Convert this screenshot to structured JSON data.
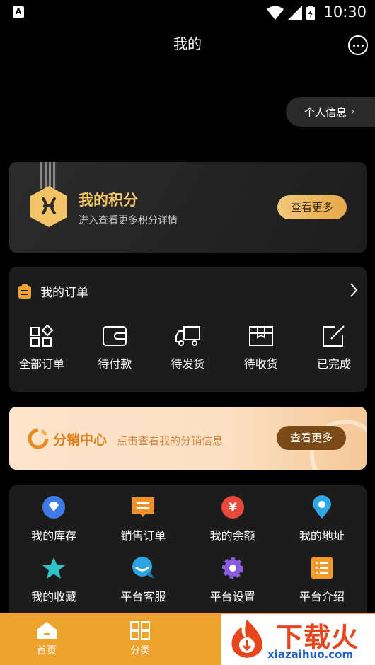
{
  "status_bar": {
    "app_badge": "A",
    "time": "10:30"
  },
  "header": {
    "title": "我的"
  },
  "profile_pill": {
    "label": "个人信息",
    "chevron": "›"
  },
  "points_card": {
    "title": "我的积分",
    "subtitle": "进入查看更多积分详情",
    "button": "查看更多"
  },
  "orders": {
    "title": "我的订单",
    "items": [
      {
        "label": "全部订单",
        "icon": "grid-icon"
      },
      {
        "label": "待付款",
        "icon": "wallet-icon"
      },
      {
        "label": "待发货",
        "icon": "truck-icon"
      },
      {
        "label": "待收货",
        "icon": "box-icon"
      },
      {
        "label": "已完成",
        "icon": "edit-icon"
      }
    ]
  },
  "distribution": {
    "title": "分销中心",
    "subtitle": "点击查看我的分销信息",
    "button": "查看更多"
  },
  "grid": {
    "items": [
      {
        "label": "我的库存",
        "icon": "diamond-icon",
        "color": "#3f7be8"
      },
      {
        "label": "销售订单",
        "icon": "receipt-icon",
        "color": "#f0902a"
      },
      {
        "label": "我的余额",
        "icon": "yen-icon",
        "color": "#e8493b"
      },
      {
        "label": "我的地址",
        "icon": "location-pin-icon",
        "color": "#2fa8e6"
      },
      {
        "label": "我的收藏",
        "icon": "star-icon",
        "color": "#2ec3c8"
      },
      {
        "label": "平台客服",
        "icon": "chat-icon",
        "color": "#2aa3e0"
      },
      {
        "label": "平台设置",
        "icon": "settings-icon",
        "color": "#8a5ce0"
      },
      {
        "label": "平台介绍",
        "icon": "list-icon",
        "color": "#f29a2a"
      }
    ]
  },
  "bottom_nav": [
    {
      "label": "首页",
      "icon": "home-icon"
    },
    {
      "label": "分类",
      "icon": "category-icon"
    }
  ],
  "watermark": {
    "text": "下载火",
    "url": "xiazaihuo.com"
  },
  "colors": {
    "accent": "#f0a22e",
    "gold": "#f2c367",
    "card": "#1c1c1c"
  }
}
